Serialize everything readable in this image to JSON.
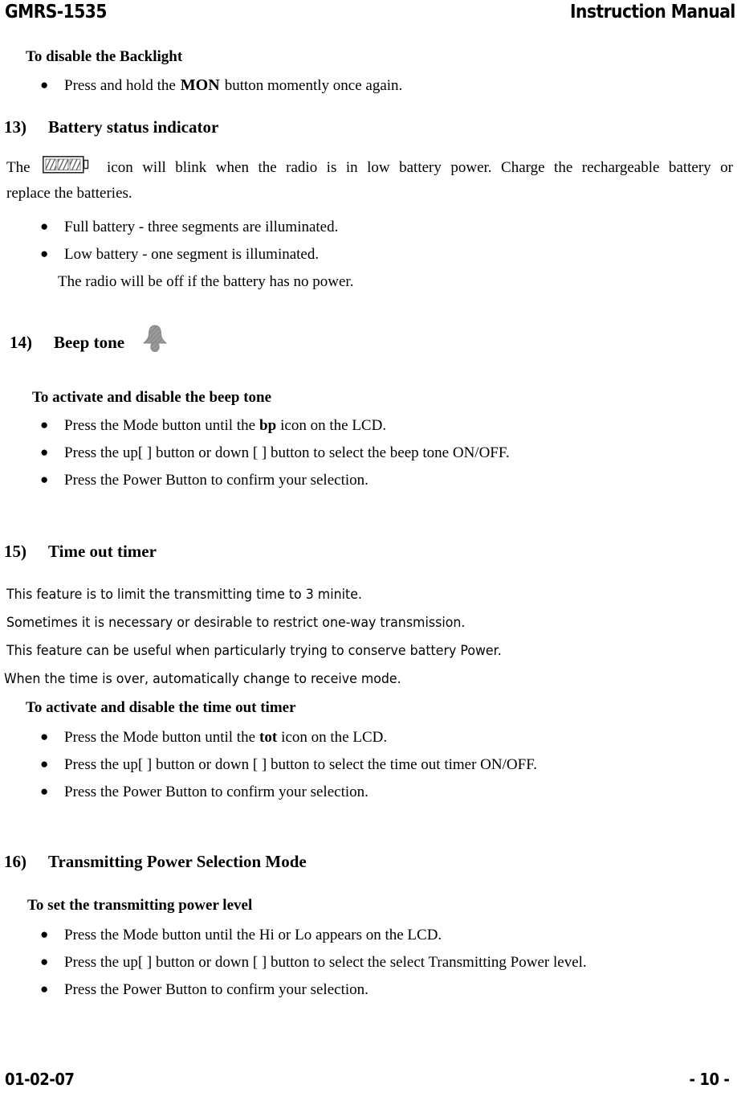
{
  "header": {
    "model": "GMRS-1535",
    "title": "Instruction Manual"
  },
  "backlight": {
    "heading": "To disable the Backlight",
    "bullet_prefix": "Press and hold the",
    "button_label": "MON",
    "bullet_suffix": "button momently once again."
  },
  "section13": {
    "number": "13)",
    "title": "Battery status indicator",
    "para_before_icon": "The",
    "icon_name": "battery-icon",
    "para_line1_after_icon": "icon will blink when the radio is in low battery power. Charge the rechargeable battery or",
    "para_line2": "replace the batteries.",
    "bullets": [
      "Full battery - three segments are illuminated.",
      "Low battery - one segment is illuminated."
    ],
    "note": "The radio will be off if the battery has no power."
  },
  "section14": {
    "number": "14)",
    "title": "Beep tone",
    "icon_name": "bell-icon",
    "sub_heading": "To activate and disable the beep tone",
    "bullets": [
      {
        "before": "Press the Mode button until the",
        "kbd": "bp",
        "after": "icon on the LCD."
      },
      {
        "text": "Press the up[   ] button or down [   ] button to select the  beep tone ON/OFF."
      },
      {
        "text": "Press the Power Button to confirm your selection."
      }
    ]
  },
  "section15": {
    "number": "15)",
    "title": "Time out timer",
    "intro_lines": [
      "This feature is to limit the transmitting time to 3 minite.",
      "Sometimes it is necessary or desirable to restrict one-way transmission.",
      "This feature can be useful when particularly trying to conserve battery Power.",
      "When the time is over, automatically change to receive mode."
    ],
    "sub_heading": "To activate and disable the time out timer",
    "bullets": [
      {
        "before": "Press the Mode button until the",
        "kbd": "tot",
        "after": "icon on the LCD."
      },
      {
        "text": "Press the up[   ] button or down [   ] button to select  the time out timer ON/OFF."
      },
      {
        "text": "Press the Power Button to confirm your selection."
      }
    ]
  },
  "section16": {
    "number": "16)",
    "title": "Transmitting Power Selection Mode",
    "sub_heading": "To set the transmitting power level",
    "bullets": [
      "Press the Mode button until the Hi or Lo appears on the LCD.",
      "Press the up[   ] button or down [   ] button to select  the select Transmitting Power level.",
      "Press the Power Button to confirm your selection."
    ]
  },
  "footer": {
    "date": "01-02-07",
    "page": "-  10  -"
  },
  "bullet_glyph": "●"
}
